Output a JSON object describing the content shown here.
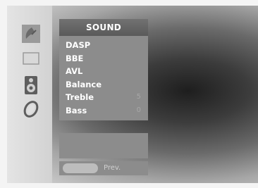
{
  "menu": {
    "title": "SOUND",
    "items": [
      {
        "label": "DASP",
        "value": ""
      },
      {
        "label": "BBE",
        "value": ""
      },
      {
        "label": "AVL",
        "value": ""
      },
      {
        "label": "Balance",
        "value": ""
      },
      {
        "label": "Treble",
        "value": "5"
      },
      {
        "label": "Bass",
        "value": "0"
      }
    ]
  },
  "sidebar": {
    "icons": [
      "satellite-dish-icon",
      "picture-icon",
      "speaker-icon",
      "time-icon",
      "option-icon"
    ]
  },
  "nav": {
    "prev_label": "Prev."
  },
  "colors": {
    "menu_bg": "#8c8c8c",
    "title_bg": "#5a5a5a",
    "text": "#ffffff"
  }
}
